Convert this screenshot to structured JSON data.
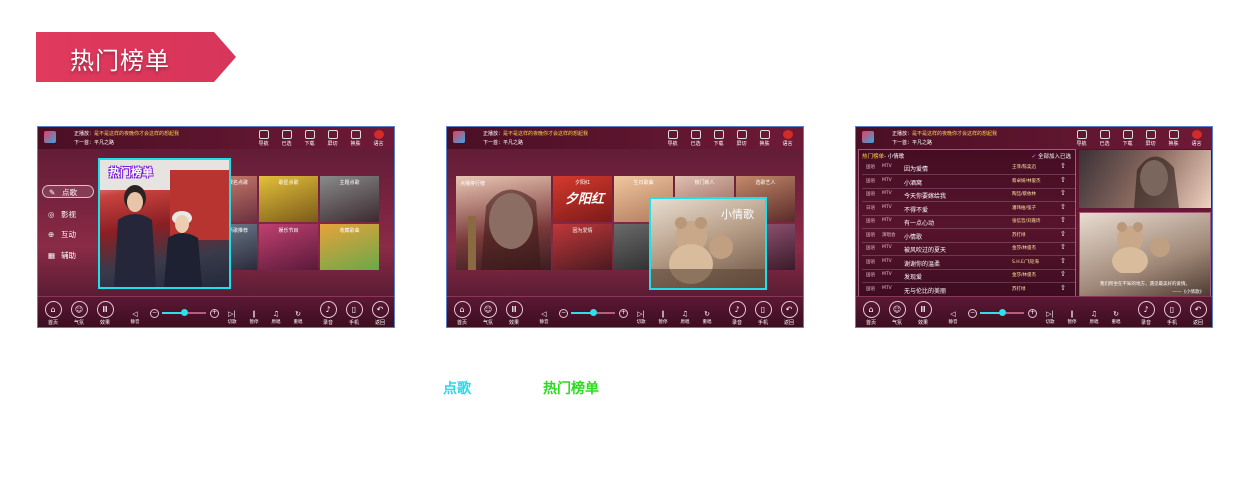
{
  "banner": {
    "title": "热门榜单",
    "color": "#d9365a"
  },
  "topbar": {
    "now_playing_label": "正播放：",
    "now_playing_song": "是不是这样的夜晚你才会这样的想起我",
    "next_label": "下一首：",
    "next_song": "平凡之路",
    "items": [
      {
        "label": "导航",
        "icon": "compass-icon"
      },
      {
        "label": "已选",
        "icon": "list-icon"
      },
      {
        "label": "下载",
        "icon": "download-icon"
      },
      {
        "label": "屏切",
        "icon": "screen-icon"
      },
      {
        "label": "换肤",
        "icon": "shirt-icon"
      },
      {
        "label": "语言",
        "icon": "flag-icon"
      }
    ]
  },
  "bottombar": {
    "home": "首页",
    "atmosphere": "气氛",
    "effects": "效果",
    "mute": "静音",
    "cut_song": "切歌",
    "pause": "暂停",
    "original": "原唱",
    "replay": "重唱",
    "record": "录音",
    "phone": "手机",
    "back": "返回",
    "volume": 0.5
  },
  "screen1": {
    "menu": [
      "点歌",
      "影视",
      "互动",
      "辅助"
    ],
    "tiles": [
      {
        "label": "歌名点歌"
      },
      {
        "label": "歌星点歌"
      },
      {
        "label": "主题点歌"
      },
      {
        "label": "新歌推荐"
      },
      {
        "label": "娱乐节目"
      },
      {
        "label": "收藏歌曲"
      }
    ],
    "highlight": "热门榜单"
  },
  "screen2": {
    "tiles": [
      {
        "label": "点播排行榜"
      },
      {
        "label": "夕阳红"
      },
      {
        "label": "生日歌曲"
      },
      {
        "label": "因为爱情"
      },
      {
        "label": "热门新人"
      },
      {
        "label": "选歌艺人"
      }
    ],
    "overlay_word": "夕阳红",
    "highlight": "小情歌"
  },
  "screen3": {
    "header_title": "热门榜单",
    "header_sub": "- 小情歌",
    "add_all": "全部加入已选",
    "songs": [
      {
        "lang": "国语",
        "type": "MTV",
        "title": "因为爱情",
        "artist": "王菲/陈奕迅"
      },
      {
        "lang": "国语",
        "type": "MTV",
        "title": "小酒窝",
        "artist": "蔡卓妍/林俊杰"
      },
      {
        "lang": "国语",
        "type": "MTV",
        "title": "今天你要嫁给我",
        "artist": "陶喆/蔡依林"
      },
      {
        "lang": "日语",
        "type": "MTV",
        "title": "不得不爱",
        "artist": "潘玮柏/弦子"
      },
      {
        "lang": "国语",
        "type": "MTV",
        "title": "有一点心动",
        "artist": "张信哲/刘嘉玲"
      },
      {
        "lang": "国语",
        "type": "演唱会",
        "title": "小情歌",
        "artist": "苏打绿"
      },
      {
        "lang": "国语",
        "type": "MTV",
        "title": "被风吹过的夏天",
        "artist": "金莎/林俊杰"
      },
      {
        "lang": "国语",
        "type": "MTV",
        "title": "谢谢你的温柔",
        "artist": "S.H.E/飞轮海"
      },
      {
        "lang": "国语",
        "type": "MTV",
        "title": "发现爱",
        "artist": "金莎/林俊杰"
      },
      {
        "lang": "国语",
        "type": "MTV",
        "title": "无与伦比的美丽",
        "artist": "苏打绿"
      }
    ],
    "lyric_line": "我们所坐在不知的地方，遇见最美好的爱情。",
    "lyric_credit": "——《小情歌》"
  },
  "captions": {
    "left": "点歌",
    "right": "热门榜单",
    "left_color": "#2ad8e8",
    "right_color": "#2bdc1e"
  }
}
